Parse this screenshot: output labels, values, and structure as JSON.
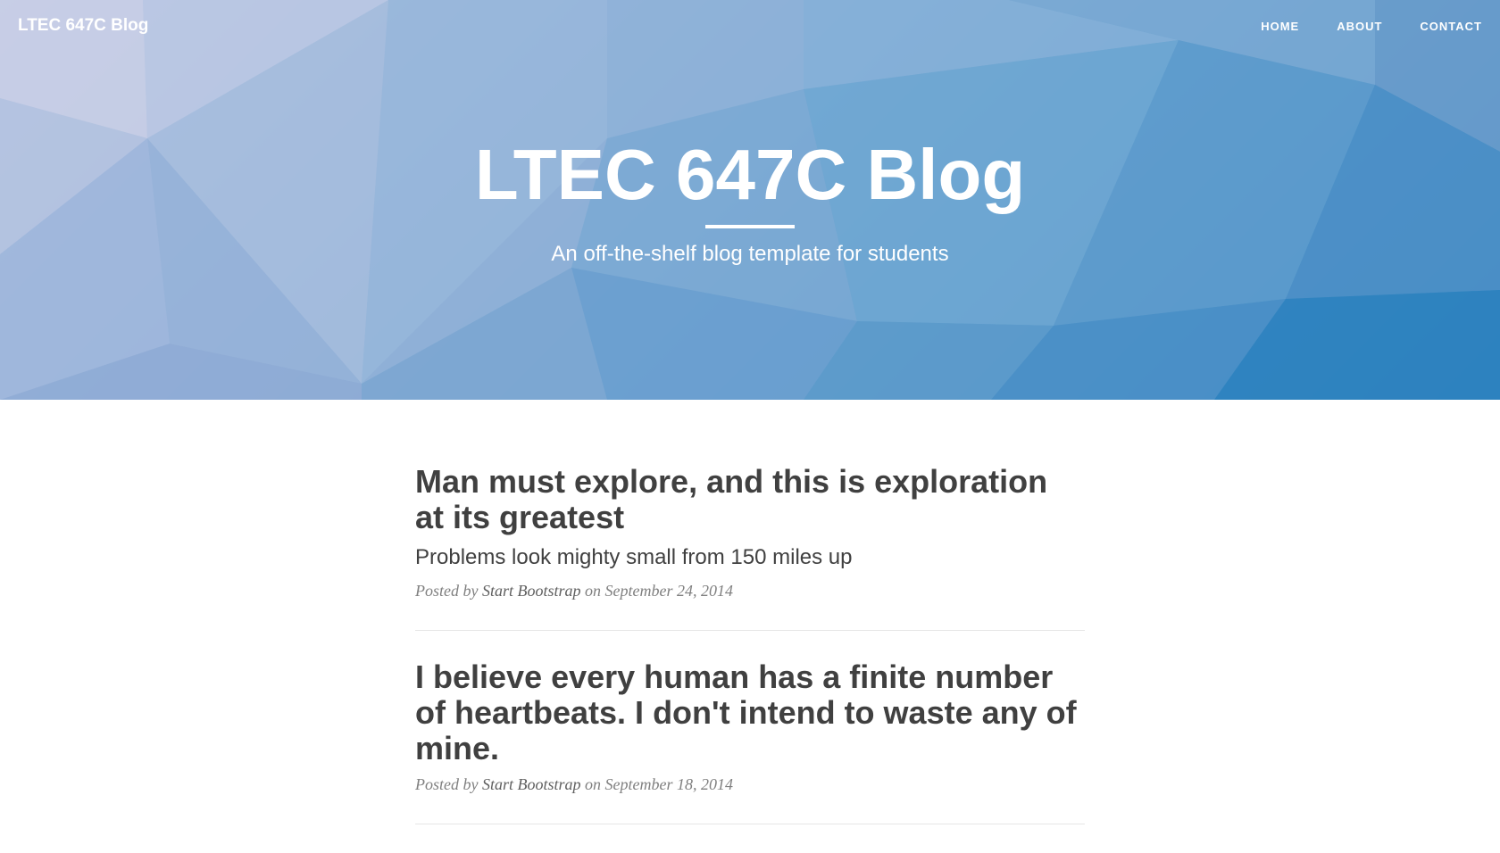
{
  "nav": {
    "brand": "LTEC 647C Blog",
    "links": [
      {
        "label": "HOME"
      },
      {
        "label": "ABOUT"
      },
      {
        "label": "CONTACT"
      }
    ]
  },
  "header": {
    "title": "LTEC 647C Blog",
    "subtitle": "An off-the-shelf blog template for students"
  },
  "posts": [
    {
      "title": "Man must explore, and this is exploration at its greatest",
      "subtitle": "Problems look mighty small from 150 miles up",
      "meta_prefix": "Posted by",
      "author": "Start Bootstrap",
      "meta_on": "on",
      "date": "September 24, 2014"
    },
    {
      "title": "I believe every human has a finite number of heartbeats. I don't intend to waste any of mine.",
      "meta_prefix": "Posted by",
      "author": "Start Bootstrap",
      "meta_on": "on",
      "date": "September 18, 2014"
    }
  ],
  "colors": {
    "header_start": "#c9cfe6",
    "header_end": "#2c84bf",
    "text": "#404040",
    "meta": "#808080"
  }
}
